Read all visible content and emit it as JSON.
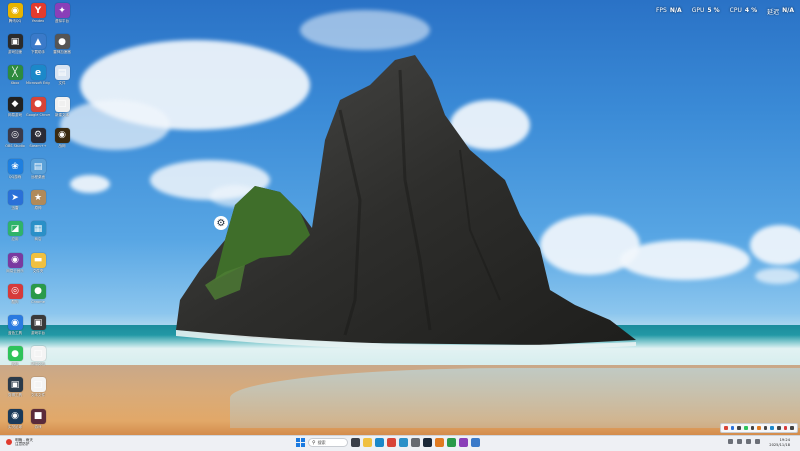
{
  "perf_overlay": {
    "fps": {
      "label": "FPS",
      "value": "N/A"
    },
    "gpu": {
      "label": "GPU",
      "value": "5 %"
    },
    "cpu": {
      "label": "CPU",
      "value": "4 %"
    },
    "latency": {
      "label": "延迟",
      "value": "N/A"
    }
  },
  "desktop_icons": [
    {
      "label": "腾讯QQ",
      "glyph": "◉",
      "color": "#e8b400"
    },
    {
      "label": "Yandex",
      "glyph": "Y",
      "color": "#e23b2e"
    },
    {
      "label": "虚拟平台",
      "glyph": "✦",
      "color": "#8a3fb8"
    },
    {
      "label": "游戏加速",
      "glyph": "▣",
      "color": "#2b2b2b"
    },
    {
      "label": "下载助手",
      "glyph": "▲",
      "color": "#3a7ac9"
    },
    {
      "label": "雷神加速器",
      "glyph": "●",
      "color": "#555555"
    },
    {
      "label": "Xbox",
      "glyph": "╳",
      "color": "#2e8b3e"
    },
    {
      "label": "Microsoft Edge",
      "glyph": "e",
      "color": "#1b88c9"
    },
    {
      "label": "文件",
      "glyph": "▤",
      "color": "#d8e4f2"
    },
    {
      "label": "网易游戏",
      "glyph": "◆",
      "color": "#222222"
    },
    {
      "label": "Google Chrome",
      "glyph": "●",
      "color": "#d84437"
    },
    {
      "label": "新建文本",
      "glyph": "□",
      "color": "#f0f0f0"
    },
    {
      "label": "OBS Studio",
      "glyph": "◎",
      "color": "#3a3a4a"
    },
    {
      "label": "Steam++",
      "glyph": "⚙",
      "color": "#2a2a35"
    },
    {
      "label": "战网",
      "glyph": "◉",
      "color": "#3a2a10"
    },
    {
      "label": "QQ游戏",
      "glyph": "❀",
      "color": "#1e7fe0"
    },
    {
      "label": "远程桌面",
      "glyph": "▤",
      "color": "#5aa0d8"
    },
    {
      "label": "迅雷",
      "glyph": "➤",
      "color": "#2a70d8"
    },
    {
      "label": "原神",
      "glyph": "★",
      "color": "#b08a5a"
    },
    {
      "label": "应用",
      "glyph": "◪",
      "color": "#2fb36a"
    },
    {
      "label": "商店",
      "glyph": "▦",
      "color": "#2a90c8"
    },
    {
      "label": "网易云音乐",
      "glyph": "◉",
      "color": "#7a3aa0"
    },
    {
      "label": "文件夹",
      "glyph": "▬",
      "color": "#f0c040"
    },
    {
      "label": "酷狗",
      "glyph": "◎",
      "color": "#d63a3a"
    },
    {
      "label": "Chrome",
      "glyph": "●",
      "color": "#2a9a4a"
    },
    {
      "label": "蓝色工具",
      "glyph": "◉",
      "color": "#2a7ae0"
    },
    {
      "label": "游戏平台",
      "glyph": "▣",
      "color": "#3a3a3a"
    },
    {
      "label": "微信",
      "glyph": "●",
      "color": "#2ec35a"
    },
    {
      "label": "新建文档",
      "glyph": "□",
      "color": "#f4f4f4"
    },
    {
      "label": "剪辑工具",
      "glyph": "▣",
      "color": "#2a3a4a"
    },
    {
      "label": "文本文件",
      "glyph": "□",
      "color": "#f4f4f4"
    },
    {
      "label": "实况足球",
      "glyph": "◉",
      "color": "#1a3a5a"
    },
    {
      "label": "游戏",
      "glyph": "■",
      "color": "#5a2a3a"
    }
  ],
  "steam_shortcut": {
    "glyph": "⚙"
  },
  "taskbar": {
    "weather": {
      "line1": "明晚 - 雨天",
      "line2": "注意防护"
    },
    "search_placeholder": "搜索",
    "apps": [
      {
        "name": "start",
        "color": "#1a7ae0"
      },
      {
        "name": "task-view",
        "color": "#3a3f48"
      },
      {
        "name": "file-explorer",
        "color": "#f0c040"
      },
      {
        "name": "edge",
        "color": "#1b88c9"
      },
      {
        "name": "chrome",
        "color": "#d84437"
      },
      {
        "name": "store",
        "color": "#2a90c8"
      },
      {
        "name": "settings",
        "color": "#666a70"
      },
      {
        "name": "steam",
        "color": "#1b2838"
      },
      {
        "name": "app-1",
        "color": "#e07a20"
      },
      {
        "name": "app-2",
        "color": "#2a9a4a"
      },
      {
        "name": "app-3",
        "color": "#8a3fb8"
      },
      {
        "name": "app-4",
        "color": "#3a7ac9"
      }
    ],
    "clock": {
      "time": "19:24",
      "date": "2025/11/18"
    }
  }
}
